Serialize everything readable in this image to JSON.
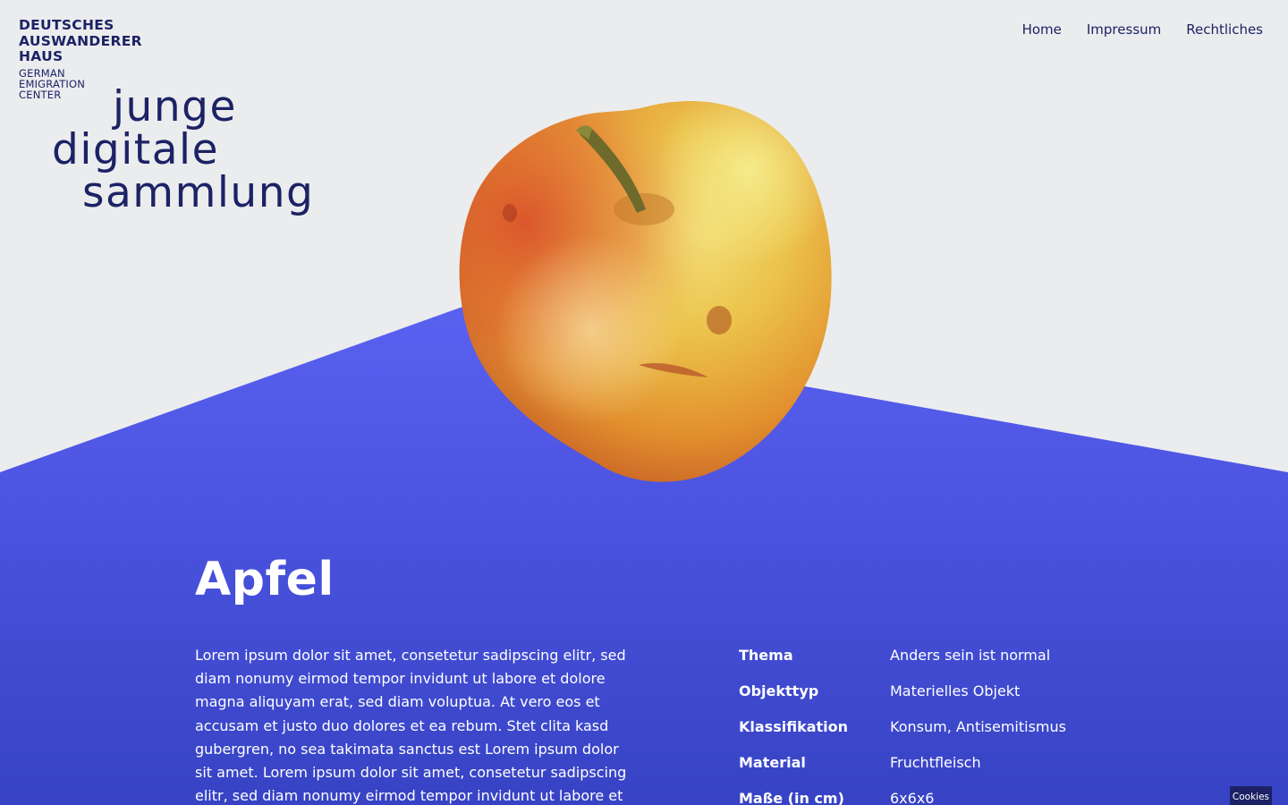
{
  "brand": {
    "line1": "DEUTSCHES",
    "line2": "AUSWANDERER",
    "line3": "HAUS",
    "sub1": "GERMAN",
    "sub2": "EMIGRATION",
    "sub3": "CENTER"
  },
  "wordmark": {
    "line1": "junge",
    "line2": "digitale",
    "line3": "sammlung"
  },
  "nav": {
    "items": [
      {
        "label": "Home"
      },
      {
        "label": "Impressum"
      },
      {
        "label": "Rechtliches"
      }
    ]
  },
  "object": {
    "title": "Apfel",
    "description": "Lorem ipsum dolor sit amet, consetetur sadipscing elitr, sed diam nonumy eirmod tempor invidunt ut labore et dolore magna aliquyam erat, sed diam voluptua. At vero eos et accusam et justo duo dolores et ea rebum. Stet clita kasd gubergren, no sea takimata sanctus est Lorem ipsum dolor sit amet. Lorem ipsum dolor sit amet, consetetur sadipscing elitr, sed diam nonumy eirmod tempor invidunt ut labore et",
    "facts": [
      {
        "key": "Thema",
        "value": "Anders sein ist normal"
      },
      {
        "key": "Objekttyp",
        "value": "Materielles Objekt"
      },
      {
        "key": "Klassifikation",
        "value": "Konsum, Antisemitismus"
      },
      {
        "key": "Material",
        "value": "Fruchtfleisch"
      },
      {
        "key": "Maße (in cm)",
        "value": "6x6x6"
      }
    ]
  },
  "cookies": {
    "label": "Cookies"
  },
  "colors": {
    "background": "#ebecee",
    "navy": "#1c2265",
    "blue_top": "#5158ea",
    "blue_bottom": "#3a45c6"
  }
}
